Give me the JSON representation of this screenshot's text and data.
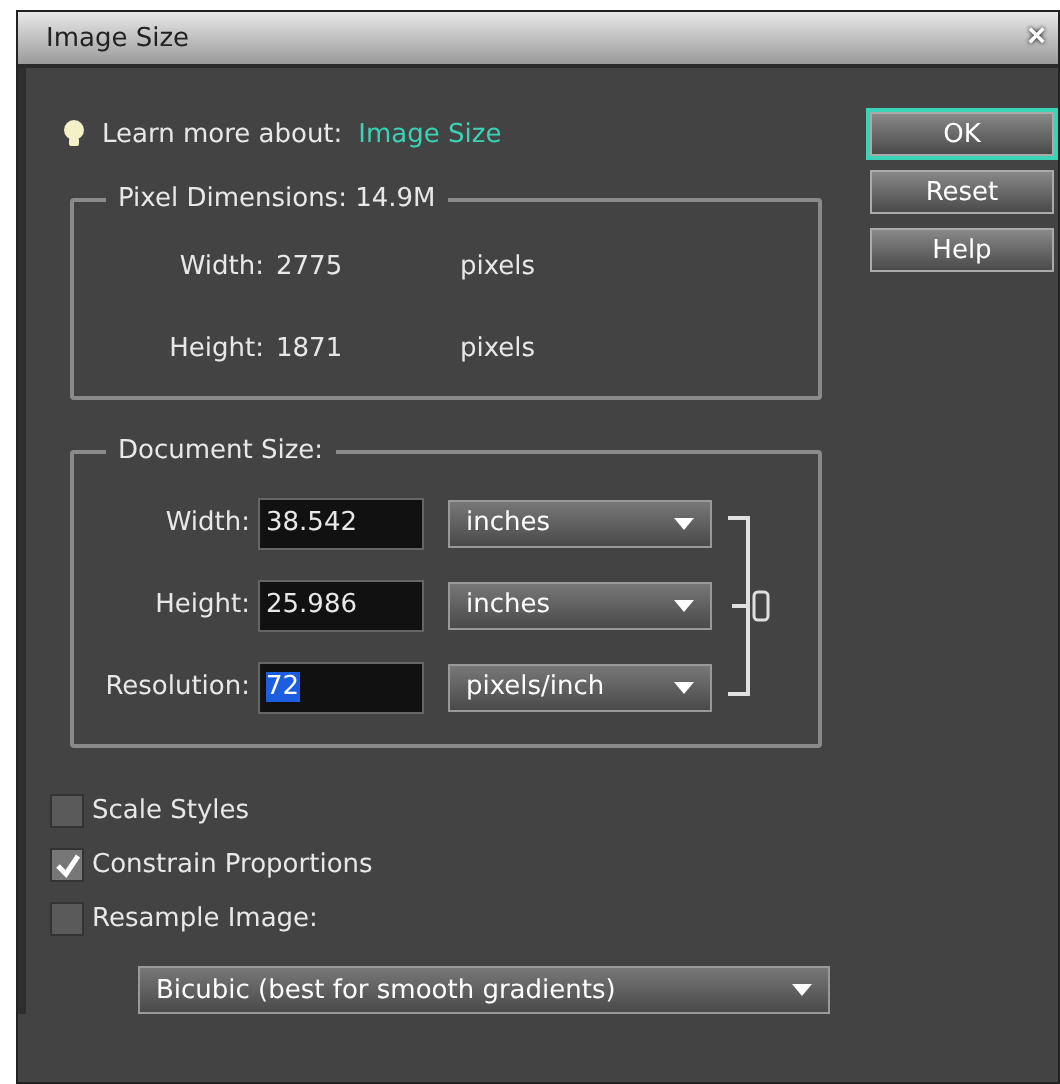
{
  "window": {
    "title": "Image Size",
    "close": "×"
  },
  "learn_more": {
    "label": "Learn more about:",
    "link": "Image Size"
  },
  "buttons": [
    {
      "label": "OK",
      "selected": true
    },
    {
      "label": "Reset",
      "selected": false
    },
    {
      "label": "Help",
      "selected": false
    }
  ],
  "pixel_dimensions": {
    "legend": "Pixel Dimensions: 14.9M",
    "rows": [
      {
        "label": "Width:",
        "value": "2775",
        "unit": "pixels"
      },
      {
        "label": "Height:",
        "value": "1871",
        "unit": "pixels"
      }
    ]
  },
  "document_size": {
    "legend": "Document Size:",
    "rows": [
      {
        "label": "Width:",
        "value": "38.542",
        "unit": "inches",
        "selected": false
      },
      {
        "label": "Height:",
        "value": "25.986",
        "unit": "inches",
        "selected": false
      },
      {
        "label": "Resolution:",
        "value": "72",
        "unit": "pixels/inch",
        "selected": true
      }
    ]
  },
  "options": [
    {
      "label": "Scale Styles",
      "checked": false
    },
    {
      "label": "Constrain Proportions",
      "checked": true
    },
    {
      "label": "Resample Image:",
      "checked": false
    }
  ],
  "resample_method": "Bicubic (best for smooth gradients)"
}
